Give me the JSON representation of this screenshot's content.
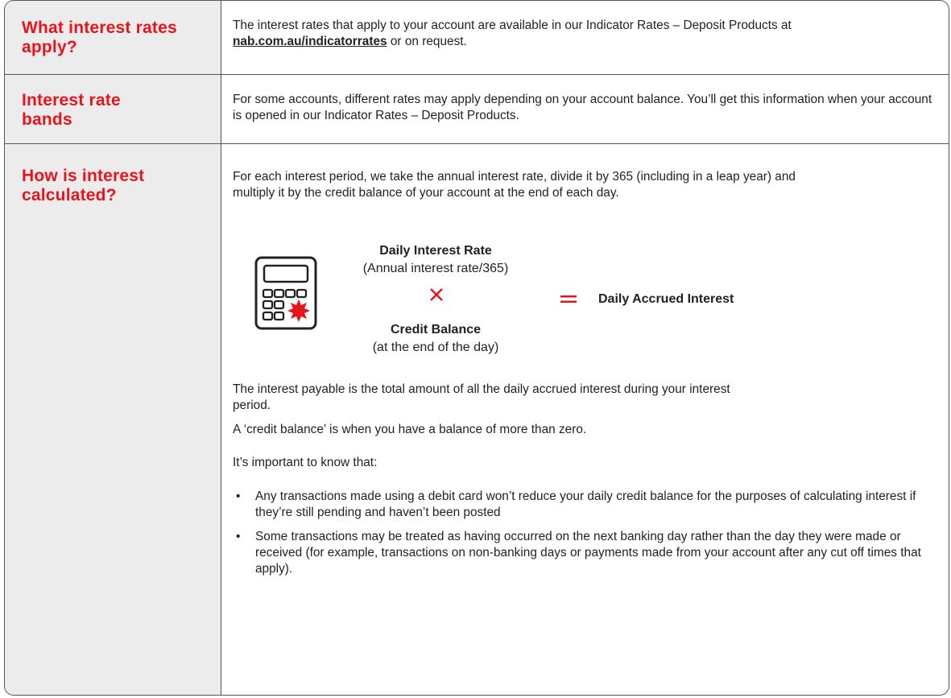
{
  "rows": [
    {
      "heading": "What interest rates apply?",
      "text_before_link": "The interest rates that apply to your account are available in our Indicator Rates – Deposit Products at ",
      "link_text": "nab.com.au/indicatorrates",
      "text_after_link": " or on request."
    },
    {
      "heading": "Interest rate bands",
      "text": "For some accounts, different rates may apply depending on your account balance. You’ll get this information when your account is opened in our Indicator Rates – Deposit Products."
    },
    {
      "heading": "How is interest calculated?",
      "intro": "For each interest period, we take the annual interest rate, divide it by 365 (including in a leap year) and multiply it by the credit balance of your account at the end of each day.",
      "formula": {
        "term1_title": "Daily Interest Rate",
        "term1_sub": "(Annual interest rate/365)",
        "term2_title": "Credit Balance",
        "term2_sub": "(at the end of the day)",
        "result": "Daily Accrued Interest"
      },
      "para1": "The interest payable is the total amount of all the daily accrued interest during your interest period.",
      "para2": "A ‘credit balance’ is when you have a balance of more than zero.",
      "para3": "It’s important to know that:",
      "bullets": [
        "Any transactions made using a debit card won’t reduce your daily credit balance for the purposes of calculating interest if they’re still pending and haven’t been posted",
        "Some transactions may be treated as having occurred on the next banking day rather than the day they were made or received (for example, transactions on non-banking days or payments made from your account after any cut off times that apply)."
      ]
    }
  ],
  "colors": {
    "accent": "#e8141d",
    "left_column_bg": "#ececec",
    "text": "#222222",
    "border": "#555555"
  },
  "icons": {
    "calculator": "calculator-icon",
    "multiply": "multiply-icon",
    "equals": "equals-icon"
  }
}
